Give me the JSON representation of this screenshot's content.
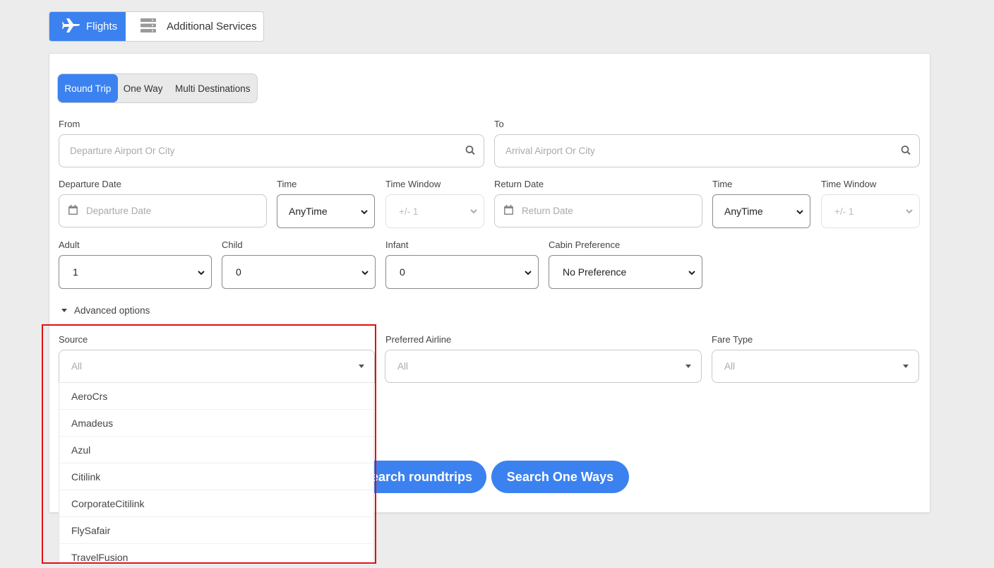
{
  "top_tabs": {
    "flights": "Flights",
    "additional_services": "Additional Services"
  },
  "trip_types": {
    "round_trip": "Round Trip",
    "one_way": "One Way",
    "multi": "Multi Destinations"
  },
  "from": {
    "label": "From",
    "placeholder": "Departure Airport Or City"
  },
  "to": {
    "label": "To",
    "placeholder": "Arrival Airport Or City"
  },
  "departure_date": {
    "label": "Departure Date",
    "placeholder": "Departure Date"
  },
  "dep_time": {
    "label": "Time",
    "value": "AnyTime"
  },
  "dep_window": {
    "label": "Time Window",
    "value": "+/- 1"
  },
  "return_date": {
    "label": "Return Date",
    "placeholder": "Return Date"
  },
  "ret_time": {
    "label": "Time",
    "value": "AnyTime"
  },
  "ret_window": {
    "label": "Time Window",
    "value": "+/- 1"
  },
  "adult": {
    "label": "Adult",
    "value": "1"
  },
  "child": {
    "label": "Child",
    "value": "0"
  },
  "infant": {
    "label": "Infant",
    "value": "0"
  },
  "cabin": {
    "label": "Cabin Preference",
    "value": "No Preference"
  },
  "advanced_options": "Advanced options",
  "source": {
    "label": "Source",
    "value": "All",
    "options": [
      "AeroCrs",
      "Amadeus",
      "Azul",
      "Citilink",
      "CorporateCitilink",
      "FlySafair",
      "TravelFusion"
    ]
  },
  "preferred_airline": {
    "label": "Preferred Airline",
    "value": "All"
  },
  "fare_type": {
    "label": "Fare Type",
    "value": "All"
  },
  "buttons": {
    "search_roundtrips": "Search roundtrips",
    "search_one_ways": "Search One Ways"
  },
  "colors": {
    "accent": "#3b82f0",
    "highlight": "#e01010"
  }
}
